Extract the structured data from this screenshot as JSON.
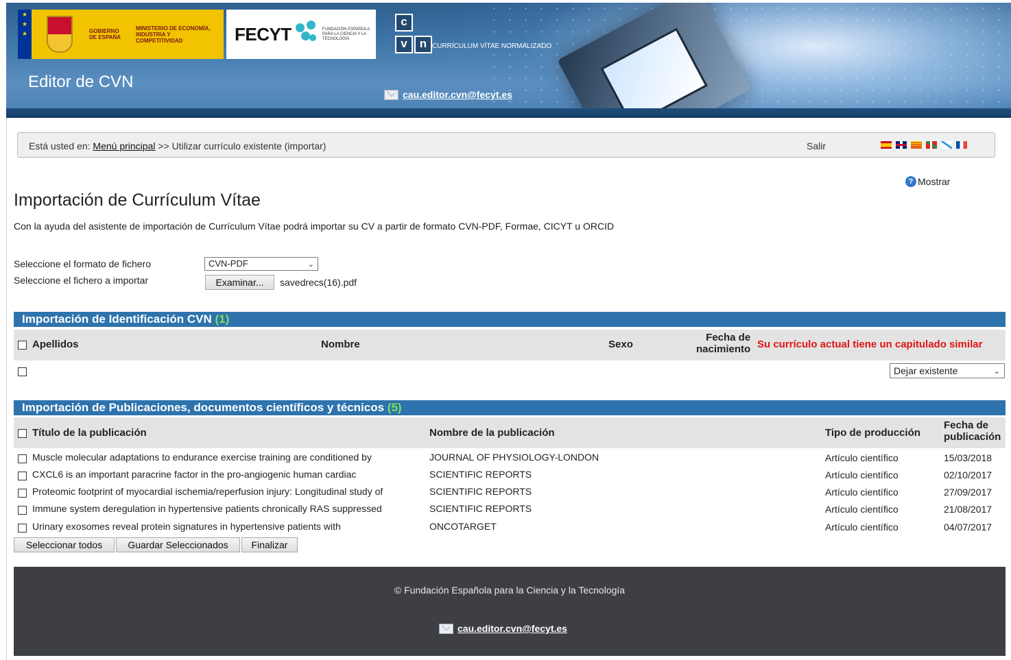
{
  "header": {
    "gov_text1": "GOBIERNO DE ESPAÑA",
    "gov_text2": "MINISTERIO DE ECONOMÍA, INDUSTRIA Y COMPETITIVIDAD",
    "fecyt_word": "FECYT",
    "fecyt_small": "FUNDACIÓN ESPAÑOLA PARA LA CIENCIA Y LA TECNOLOGÍA",
    "cvn_letters": [
      "c",
      "v",
      "n"
    ],
    "cvn_caption": "CURRÍCULUM VÍTAE NORMALIZADO",
    "app_title": "Editor de CVN",
    "email": "cau.editor.cvn@fecyt.es"
  },
  "breadcrumb": {
    "prefix": "Está usted en:",
    "home_link": "Menú principal",
    "current": ">> Utilizar currículo existente (importar)",
    "salir": "Salir",
    "flags": [
      "es",
      "en",
      "ca",
      "eu",
      "gl",
      "fr"
    ]
  },
  "help": {
    "label": "Mostrar",
    "icon": "help-icon"
  },
  "page": {
    "title": "Importación de Currículum Vítae",
    "intro": "Con la ayuda del asistente de importación de Currículum Vítae podrá importar su CV a partir de formato CVN-PDF, Formae, CICYT u ORCID"
  },
  "form": {
    "format_label": "Seleccione el formato de fichero",
    "format_value": "CVN-PDF",
    "file_label": "Seleccione el fichero a importar",
    "browse_button": "Examinar...",
    "file_name": "savedrecs(16).pdf"
  },
  "identification": {
    "title": "Importación de Identificación CVN",
    "count": "(1)",
    "columns": {
      "apellidos": "Apellidos",
      "nombre": "Nombre",
      "sexo": "Sexo",
      "fecha_1": "Fecha de",
      "fecha_2": "nacimiento"
    },
    "warning": "Su currículo actual tiene un capitulado similar",
    "action_value": "Dejar existente"
  },
  "publications": {
    "title": "Importación de Publicaciones, documentos científicos y técnicos",
    "count": "(5)",
    "columns": {
      "titulo": "Título de la publicación",
      "nombre": "Nombre de la publicación",
      "tipo": "Tipo de producción",
      "fecha_1": "Fecha de",
      "fecha_2": "publicación"
    },
    "rows": [
      {
        "titulo": "Muscle molecular adaptations to endurance exercise training are conditioned by",
        "nombre": "JOURNAL OF PHYSIOLOGY-LONDON",
        "tipo": "Artículo científico",
        "fecha": "15/03/2018"
      },
      {
        "titulo": "CXCL6 is an important paracrine factor in the pro-angiogenic human cardiac",
        "nombre": "SCIENTIFIC REPORTS",
        "tipo": "Artículo científico",
        "fecha": "02/10/2017"
      },
      {
        "titulo": "Proteomic footprint of myocardial ischemia/reperfusion injury: Longitudinal study of",
        "nombre": "SCIENTIFIC REPORTS",
        "tipo": "Artículo científico",
        "fecha": "27/09/2017"
      },
      {
        "titulo": "Immune system deregulation in hypertensive patients chronically RAS suppressed",
        "nombre": "SCIENTIFIC REPORTS",
        "tipo": "Artículo científico",
        "fecha": "21/08/2017"
      },
      {
        "titulo": "Urinary exosomes reveal protein signatures in hypertensive patients with",
        "nombre": "ONCOTARGET",
        "tipo": "Artículo científico",
        "fecha": "04/07/2017"
      }
    ]
  },
  "buttons": {
    "select_all": "Seleccionar todos",
    "save_selected": "Guardar Seleccionados",
    "finish": "Finalizar"
  },
  "footer": {
    "copyright": "© Fundación Española para la Ciencia y la Tecnología",
    "email": "cau.editor.cvn@fecyt.es"
  },
  "colors": {
    "section_header": "#2e73ad",
    "count_green": "#7ee05a",
    "warning_red": "#e01414",
    "footer_bg": "#3d3f45"
  }
}
